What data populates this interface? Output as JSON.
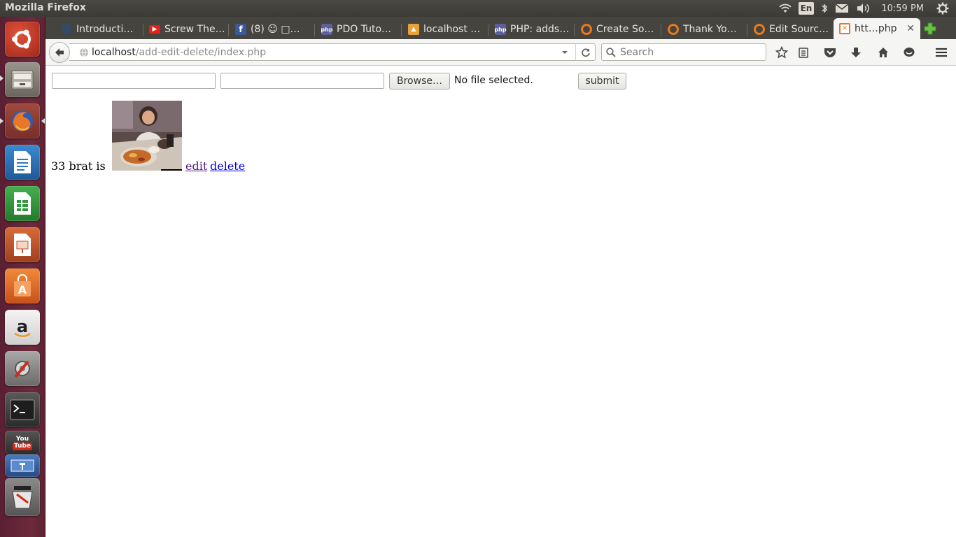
{
  "panel": {
    "app_title": "Mozilla Firefox",
    "keyboard_layout": "En",
    "clock": "10:59 PM"
  },
  "launcher": {
    "items": [
      {
        "name": "ubuntu-dash",
        "icon": "ubuntu-logo-icon",
        "color": "#c0392b"
      },
      {
        "name": "files",
        "icon": "file-cabinet-icon",
        "color": "#8a8478"
      },
      {
        "name": "firefox",
        "icon": "firefox-icon",
        "color": "#e8772a"
      },
      {
        "name": "libreoffice-writer",
        "icon": "writer-document-icon",
        "color": "#2a78c0"
      },
      {
        "name": "libreoffice-calc",
        "icon": "calc-spreadsheet-icon",
        "color": "#2f9a3a"
      },
      {
        "name": "libreoffice-impress",
        "icon": "impress-presentation-icon",
        "color": "#c0542a"
      },
      {
        "name": "software-center",
        "icon": "shopping-bag-icon",
        "color": "#e8662a"
      },
      {
        "name": "amazon",
        "icon": "amazon-icon",
        "color": "#e6e6e6"
      },
      {
        "name": "system-settings",
        "icon": "settings-wrench-icon",
        "color": "#8a8a8a"
      },
      {
        "name": "terminal",
        "icon": "terminal-icon",
        "color": "#2b2b2b"
      },
      {
        "name": "youtube",
        "icon": "youtube-icon",
        "color": "#3a3a3a",
        "label_top": "You",
        "label_bottom": "Tube"
      },
      {
        "name": "workspace-stack",
        "icon": "workspace-icon",
        "color": "#3a6ab0"
      },
      {
        "name": "trash",
        "icon": "trash-icon",
        "color": "#777777"
      }
    ]
  },
  "tabs": [
    {
      "title": "Introducti…",
      "icon": "page-icon",
      "color": "#344a66"
    },
    {
      "title": "Screw The…",
      "icon": "youtube-play-icon",
      "color": "#e62117"
    },
    {
      "title": "(8) ☺ □…",
      "icon": "facebook-icon",
      "color": "#3b5998"
    },
    {
      "title": "PDO Tuto…",
      "icon": "php-icon",
      "color": "#5b5f9a"
    },
    {
      "title": "localhost …",
      "icon": "phpmyadmin-icon",
      "color": "#e8a23a"
    },
    {
      "title": "PHP: adds…",
      "icon": "php-icon",
      "color": "#5b5f9a"
    },
    {
      "title": "Create So…",
      "icon": "quora-icon",
      "color": "#e87a1a"
    },
    {
      "title": "Thank Yo…",
      "icon": "quora-icon",
      "color": "#e87a1a"
    },
    {
      "title": "Edit Sourc…",
      "icon": "quora-icon",
      "color": "#e87a1a"
    },
    {
      "title": "htt…php",
      "icon": "xampp-icon",
      "color": "#e8772a",
      "active": true
    }
  ],
  "navbar": {
    "url_host": "localhost",
    "url_path": "/add-edit-delete/index.php",
    "search_placeholder": "Search"
  },
  "form": {
    "field1_value": "",
    "field2_value": "",
    "browse_label": "Browse…",
    "file_status": "No file selected.",
    "submit_label": "submit"
  },
  "record": {
    "text": "33 brat is",
    "edit_label": "edit",
    "delete_label": "delete"
  }
}
